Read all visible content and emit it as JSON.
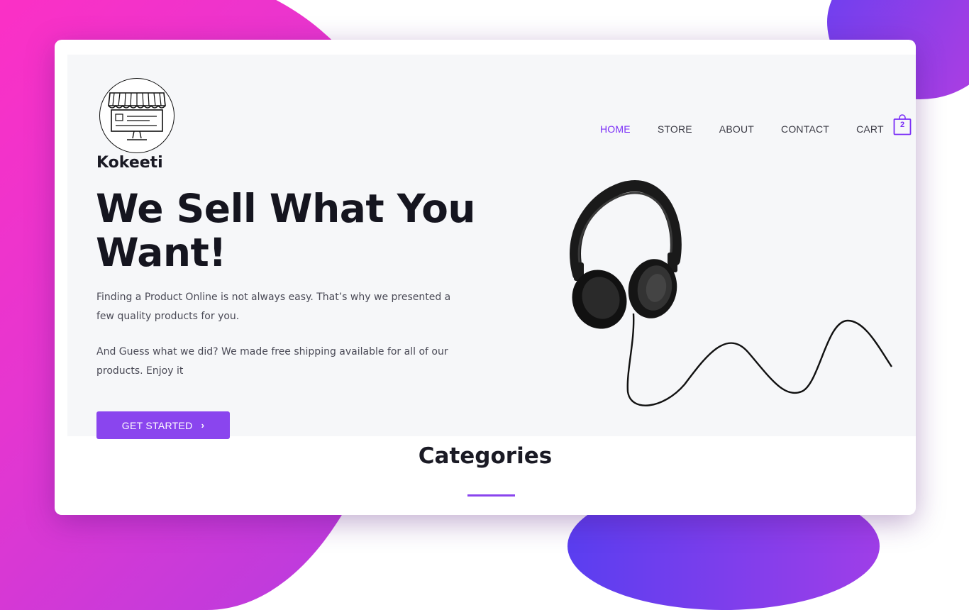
{
  "colors": {
    "accent": "#8a45ee",
    "nav_active": "#7b2ff7",
    "background_pink": "#ff2fc4",
    "background_purple": "#6a3ff0",
    "hero_bg": "#f6f7f9",
    "heading": "#15151f"
  },
  "brand": {
    "name": "Kokeeti",
    "logo_icon": "storefront-icon"
  },
  "nav": {
    "items": [
      {
        "label": "HOME",
        "active": true
      },
      {
        "label": "STORE",
        "active": false
      },
      {
        "label": "ABOUT",
        "active": false
      },
      {
        "label": "CONTACT",
        "active": false
      },
      {
        "label": "CART",
        "active": false
      }
    ],
    "cart_icon": "shopping-bag-icon",
    "cart_count": "2"
  },
  "hero": {
    "headline": "We Sell What You Want!",
    "paragraph1": "Finding a Product Online is not always easy. That’s why we presented a few quality products for you.",
    "paragraph2": "And Guess what we did? We made free shipping available for all of our products. Enjoy it",
    "cta_label": "GET STARTED",
    "cta_icon": "chevron-right-icon",
    "image_icon": "headphones-image"
  },
  "categories": {
    "title": "Categories"
  }
}
